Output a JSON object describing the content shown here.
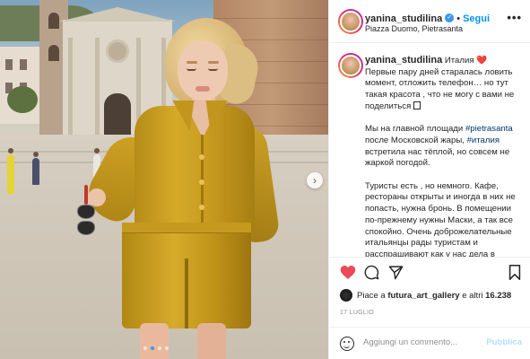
{
  "post": {
    "username": "yanina_studilina",
    "follow_label": "Segui",
    "separator": "•",
    "location": "Piazza Duomo, Pietrasanta",
    "more_label": "•••",
    "caption": {
      "line1_text": "Италия",
      "line1_emoji": "❤️",
      "para1": "Первые пару дней старалась ловить момент, отложить телефон… но тут такая красота , что не могу с вами не поделиться",
      "para2_a": "Мы на главной площади",
      "tag1": "#pietrasanta",
      "para2_b": "после Московской жары,",
      "tag2": "#италия",
      "para2_c": "встретила нас тёплой, но совсем не жаркой погодой.",
      "para3": "Туристы есть , но немного. Кафе, рестораны открыты и иногда в них не попасть, нужна бронь. В помещении по-прежнему нужны Маски, а так все спокойно. Очень доброжелательные итальянцы рады туристам и расспрашивают как у нас дела в России"
    },
    "likes": {
      "prefix": "Piace a",
      "user": "futura_art_gallery",
      "middle": "e altri",
      "count": "16.238"
    },
    "date": "17 LUGLIO",
    "comment": {
      "placeholder": "Aggiungi un commento...",
      "publish_label": "Pubblica"
    },
    "carousel": {
      "next_icon": "›",
      "dot_count": 4,
      "active_dot": 1
    }
  },
  "colors": {
    "accent": "#0095f6",
    "like_red": "#ed4956",
    "publish_disabled": "#b2dffc"
  }
}
